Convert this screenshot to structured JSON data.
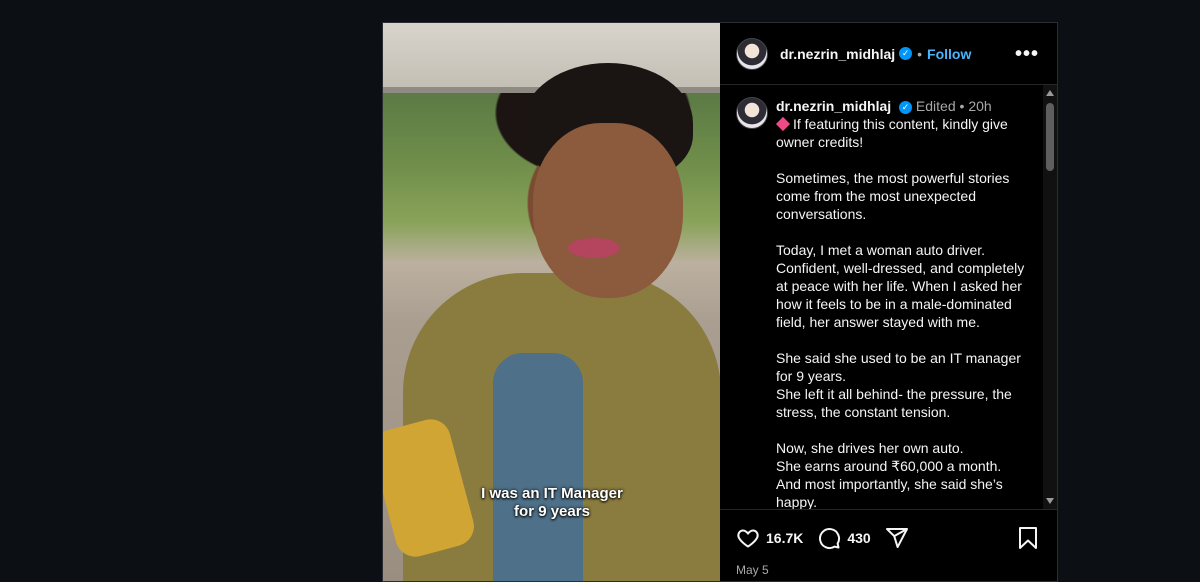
{
  "post": {
    "username": "dr.nezrin_midhlaj",
    "follow_label": "Follow",
    "separator": "•",
    "caption_overlay_line1": "I was an IT Manager",
    "caption_overlay_line2": "for 9 years"
  },
  "comment": {
    "username": "dr.nezrin_midhlaj",
    "edited": "Edited",
    "time": "20h",
    "paragraphs": [
      "If featuring this content, kindly give owner credits!",
      "Sometimes, the most powerful stories come from the most unexpected conversations.",
      "Today, I met a woman auto driver. Confident, well-dressed, and completely at peace with her life. When I asked her how it feels to be in a male-dominated field, her answer stayed with me.",
      "She said she used to be an IT manager for 9 years.\nShe left it all behind- the pressure, the stress, the constant tension.",
      "Now, she drives her own auto.\nShe earns around ₹60,000 a month.\nAnd most importantly, she said she’s happy."
    ]
  },
  "actions": {
    "likes": "16.7K",
    "comments": "430"
  },
  "date": "May 5",
  "icons": [
    "verified-icon",
    "more-options-icon",
    "heart-icon",
    "comment-icon",
    "share-icon",
    "bookmark-icon",
    "diamond-icon"
  ]
}
